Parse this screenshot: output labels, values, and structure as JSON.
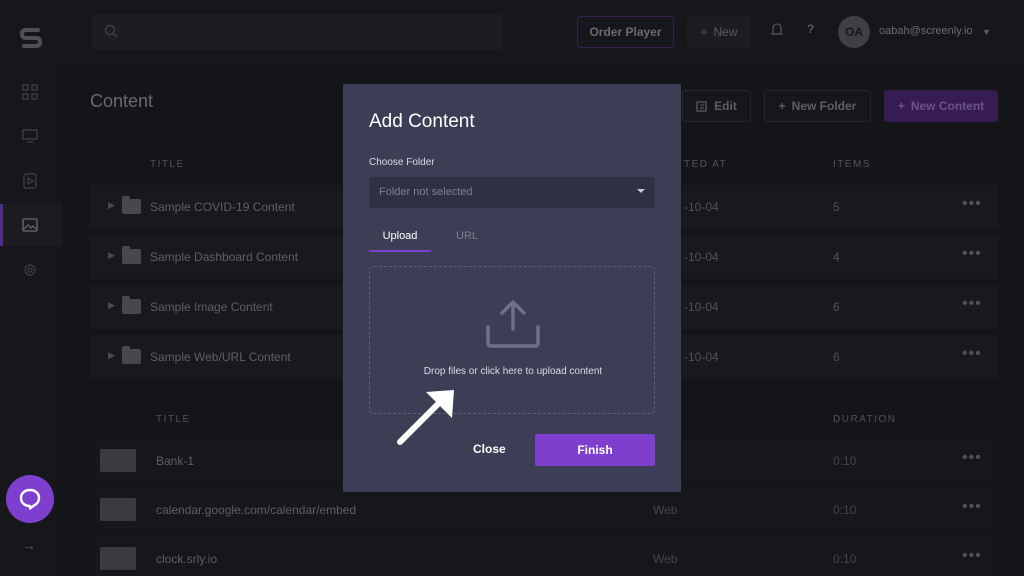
{
  "topbar": {
    "order_player_label": "Order Player",
    "new_label": "New",
    "help_label": "?",
    "avatar_initials": "OA",
    "user_email": "oabah@screenly.io"
  },
  "page": {
    "title": "Content",
    "edit_label": "Edit",
    "new_folder_label": "New Folder",
    "new_content_label": "New Content"
  },
  "folders_table": {
    "headers": {
      "title": "TITLE",
      "created_at": "TED AT",
      "items": "ITEMS"
    },
    "rows": [
      {
        "name": "Sample COVID-19 Content",
        "date": "-10-04",
        "items": "5"
      },
      {
        "name": "Sample Dashboard Content",
        "date": "-10-04",
        "items": "4"
      },
      {
        "name": "Sample Image Content",
        "date": "-10-04",
        "items": "6"
      },
      {
        "name": "Sample Web/URL Content",
        "date": "-10-04",
        "items": "6"
      }
    ]
  },
  "media_table": {
    "headers": {
      "title": "TITLE",
      "duration": "DURATION"
    },
    "rows": [
      {
        "name": "Bank-1",
        "type": "ge",
        "duration": "0:10"
      },
      {
        "name": "calendar.google.com/calendar/embed",
        "type": "Web",
        "duration": "0:10"
      },
      {
        "name": "clock.srly.io",
        "type": "Web",
        "duration": "0:10"
      }
    ]
  },
  "modal": {
    "title": "Add Content",
    "choose_folder_label": "Choose Folder",
    "folder_placeholder": "Folder not selected",
    "tabs": [
      "Upload",
      "URL"
    ],
    "dropzone_text": "Drop files or click here to upload content",
    "close_label": "Close",
    "finish_label": "Finish"
  },
  "colors": {
    "accent": "#7e3fcf",
    "modal_bg": "#3c3e55",
    "app_bg": "#1b1c21"
  },
  "icons": [
    "screenly-logo-icon",
    "dashboard-icon",
    "screen-icon",
    "playlist-icon",
    "image-icon",
    "settings-icon",
    "search-icon",
    "bell-icon",
    "folder-icon",
    "upload-icon",
    "chat-icon",
    "arrow-right-icon"
  ]
}
